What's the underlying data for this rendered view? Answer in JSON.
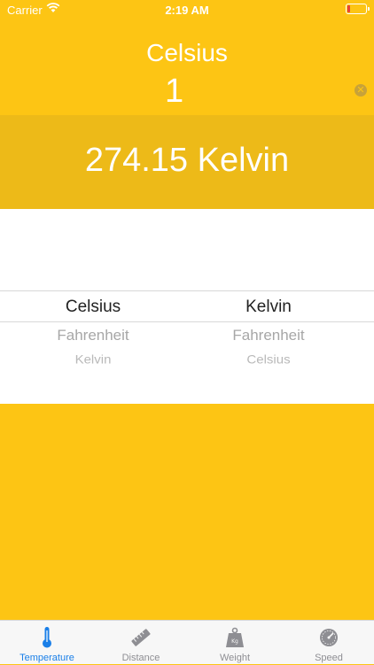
{
  "status_bar": {
    "carrier": "Carrier",
    "time": "2:19 AM"
  },
  "converter": {
    "from_unit": "Celsius",
    "input_value": "1",
    "result": "274.15 Kelvin"
  },
  "picker": {
    "from_options": [
      "Celsius",
      "Fahrenheit",
      "Kelvin"
    ],
    "to_options": [
      "Kelvin",
      "Fahrenheit",
      "Celsius"
    ],
    "from_selected": "Celsius",
    "to_selected": "Kelvin"
  },
  "tabs": [
    {
      "label": "Temperature",
      "icon": "thermometer-icon",
      "active": true
    },
    {
      "label": "Distance",
      "icon": "ruler-icon",
      "active": false
    },
    {
      "label": "Weight",
      "icon": "weight-icon",
      "active": false
    },
    {
      "label": "Speed",
      "icon": "speedometer-icon",
      "active": false
    }
  ],
  "colors": {
    "background": "#FDC514",
    "result_band": "#EDBA18",
    "active_tab": "#1A7FE8",
    "inactive_tab": "#8E8E93"
  }
}
